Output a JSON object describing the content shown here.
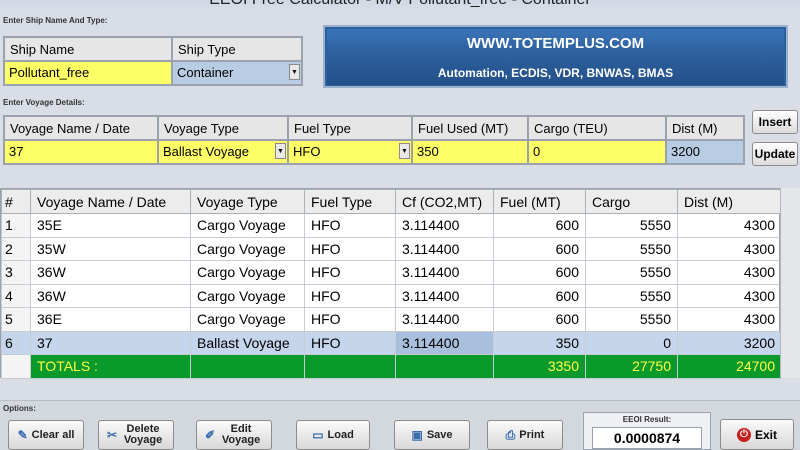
{
  "window": {
    "title": "EEOI Free Calculator - M/V Pollutant_free - Container"
  },
  "ship_section": {
    "label": "Enter Ship Name And Type:",
    "name_header": "Ship Name",
    "type_header": "Ship Type",
    "name_value": "Pollutant_free",
    "type_value": "Container"
  },
  "banner": {
    "url": "WWW.TOTEMPLUS.COM",
    "tagline": "Automation, ECDIS, VDR, BNWAS, BMAS"
  },
  "voyage_section": {
    "label": "Enter Voyage Details:",
    "headers": [
      "Voyage Name / Date",
      "Voyage Type",
      "Fuel Type",
      "Fuel Used (MT)",
      "Cargo (TEU)",
      "Dist (M)"
    ],
    "values": {
      "name": "37",
      "type": "Ballast Voyage",
      "fuel_type": "HFO",
      "fuel_used": "350",
      "cargo": "0",
      "dist": "3200"
    },
    "insert_label": "Insert",
    "update_label": "Update"
  },
  "table": {
    "headers": [
      "#",
      "Voyage Name / Date",
      "Voyage Type",
      "Fuel Type",
      "Cf (CO2,MT)",
      "Fuel (MT)",
      "Cargo",
      "Dist (M)"
    ],
    "rows": [
      {
        "idx": "1",
        "name": "35E",
        "type": "Cargo Voyage",
        "fuel": "HFO",
        "cf": "3.114400",
        "fuel_mt": "600",
        "cargo": "5550",
        "dist": "4300"
      },
      {
        "idx": "2",
        "name": "35W",
        "type": "Cargo Voyage",
        "fuel": "HFO",
        "cf": "3.114400",
        "fuel_mt": "600",
        "cargo": "5550",
        "dist": "4300"
      },
      {
        "idx": "3",
        "name": "36W",
        "type": "Cargo Voyage",
        "fuel": "HFO",
        "cf": "3.114400",
        "fuel_mt": "600",
        "cargo": "5550",
        "dist": "4300"
      },
      {
        "idx": "4",
        "name": "36W",
        "type": "Cargo Voyage",
        "fuel": "HFO",
        "cf": "3.114400",
        "fuel_mt": "600",
        "cargo": "5550",
        "dist": "4300"
      },
      {
        "idx": "5",
        "name": "36E",
        "type": "Cargo Voyage",
        "fuel": "HFO",
        "cf": "3.114400",
        "fuel_mt": "600",
        "cargo": "5550",
        "dist": "4300"
      },
      {
        "idx": "6",
        "name": "37",
        "type": "Ballast Voyage",
        "fuel": "HFO",
        "cf": "3.114400",
        "fuel_mt": "350",
        "cargo": "0",
        "dist": "3200"
      }
    ],
    "selected_row": "6",
    "totals": {
      "label": "TOTALS :",
      "fuel_mt": "3350",
      "cargo": "27750",
      "dist": "24700"
    }
  },
  "options": {
    "label": "Options:",
    "clear_all": "Clear all",
    "delete_voyage": "Delete Voyage",
    "edit_voyage": "Edit Voyage",
    "load": "Load",
    "save": "Save",
    "print": "Print",
    "exit": "Exit"
  },
  "result": {
    "label": "EEOI Result:",
    "value": "0.0000874"
  },
  "colors": {
    "input_yellow": "#ffff66",
    "input_blue": "#b8cce4",
    "banner_blue": "#2c5f9e",
    "totals_green": "#0a9a2c",
    "totals_text": "#ffff44"
  }
}
